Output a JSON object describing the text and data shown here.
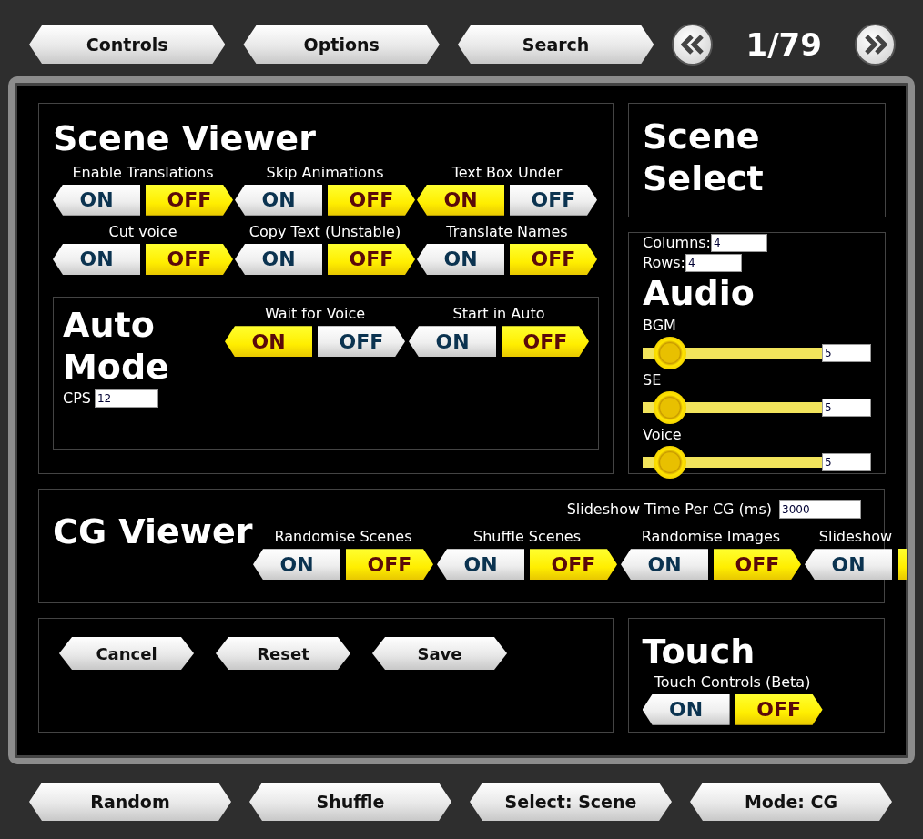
{
  "top_bar": {
    "buttons": [
      "Controls",
      "Options",
      "Search"
    ],
    "page": "1/79"
  },
  "scene_viewer": {
    "title": "Scene Viewer",
    "toggles": [
      {
        "label": "Enable Translations",
        "on_label": "ON",
        "off_label": "OFF",
        "on": false
      },
      {
        "label": "Skip Animations",
        "on_label": "ON",
        "off_label": "OFF",
        "on": false
      },
      {
        "label": "Text Box Under",
        "on_label": "ON",
        "off_label": "OFF",
        "on": true
      },
      {
        "label": "Cut voice",
        "on_label": "ON",
        "off_label": "OFF",
        "on": false
      },
      {
        "label": "Copy Text (Unstable)",
        "on_label": "ON",
        "off_label": "OFF",
        "on": false
      },
      {
        "label": "Translate Names",
        "on_label": "ON",
        "off_label": "OFF",
        "on": false
      }
    ],
    "auto_mode": {
      "title": "Auto Mode",
      "cps_label": "CPS",
      "cps_value": "12",
      "toggles": [
        {
          "label": "Wait for Voice",
          "on_label": "ON",
          "off_label": "OFF",
          "on": true
        },
        {
          "label": "Start in Auto",
          "on_label": "ON",
          "off_label": "OFF",
          "on": false
        }
      ]
    }
  },
  "scene_select": {
    "title": "Scene Select",
    "fields": [
      {
        "label": "Columns:",
        "value": "4"
      },
      {
        "label": "Rows:",
        "value": "4"
      }
    ]
  },
  "audio": {
    "title": "Audio",
    "sliders": [
      {
        "label": "BGM",
        "level": 0.15,
        "value": "5"
      },
      {
        "label": "SE",
        "level": 0.15,
        "value": "5"
      },
      {
        "label": "Voice",
        "level": 0.15,
        "value": "5"
      }
    ]
  },
  "cg_viewer": {
    "title": "CG Viewer",
    "time_label": "Slideshow Time Per CG (ms)",
    "time_value": "3000",
    "toggles": [
      {
        "label": "Randomise Scenes",
        "on_label": "ON",
        "off_label": "OFF",
        "on": false
      },
      {
        "label": "Shuffle Scenes",
        "on_label": "ON",
        "off_label": "OFF",
        "on": false
      },
      {
        "label": "Randomise Images",
        "on_label": "ON",
        "off_label": "OFF",
        "on": false
      },
      {
        "label": "Slideshow",
        "on_label": "ON",
        "on": false
      }
    ]
  },
  "actions": [
    "Cancel",
    "Reset",
    "Save"
  ],
  "touch": {
    "title": "Touch",
    "toggles": [
      {
        "label": "Touch Controls (Beta)",
        "on_label": "ON",
        "off_label": "OFF",
        "on": false
      }
    ]
  },
  "bottom_bar": [
    "Random",
    "Shuffle",
    "Select: Scene",
    "Mode: CG"
  ]
}
